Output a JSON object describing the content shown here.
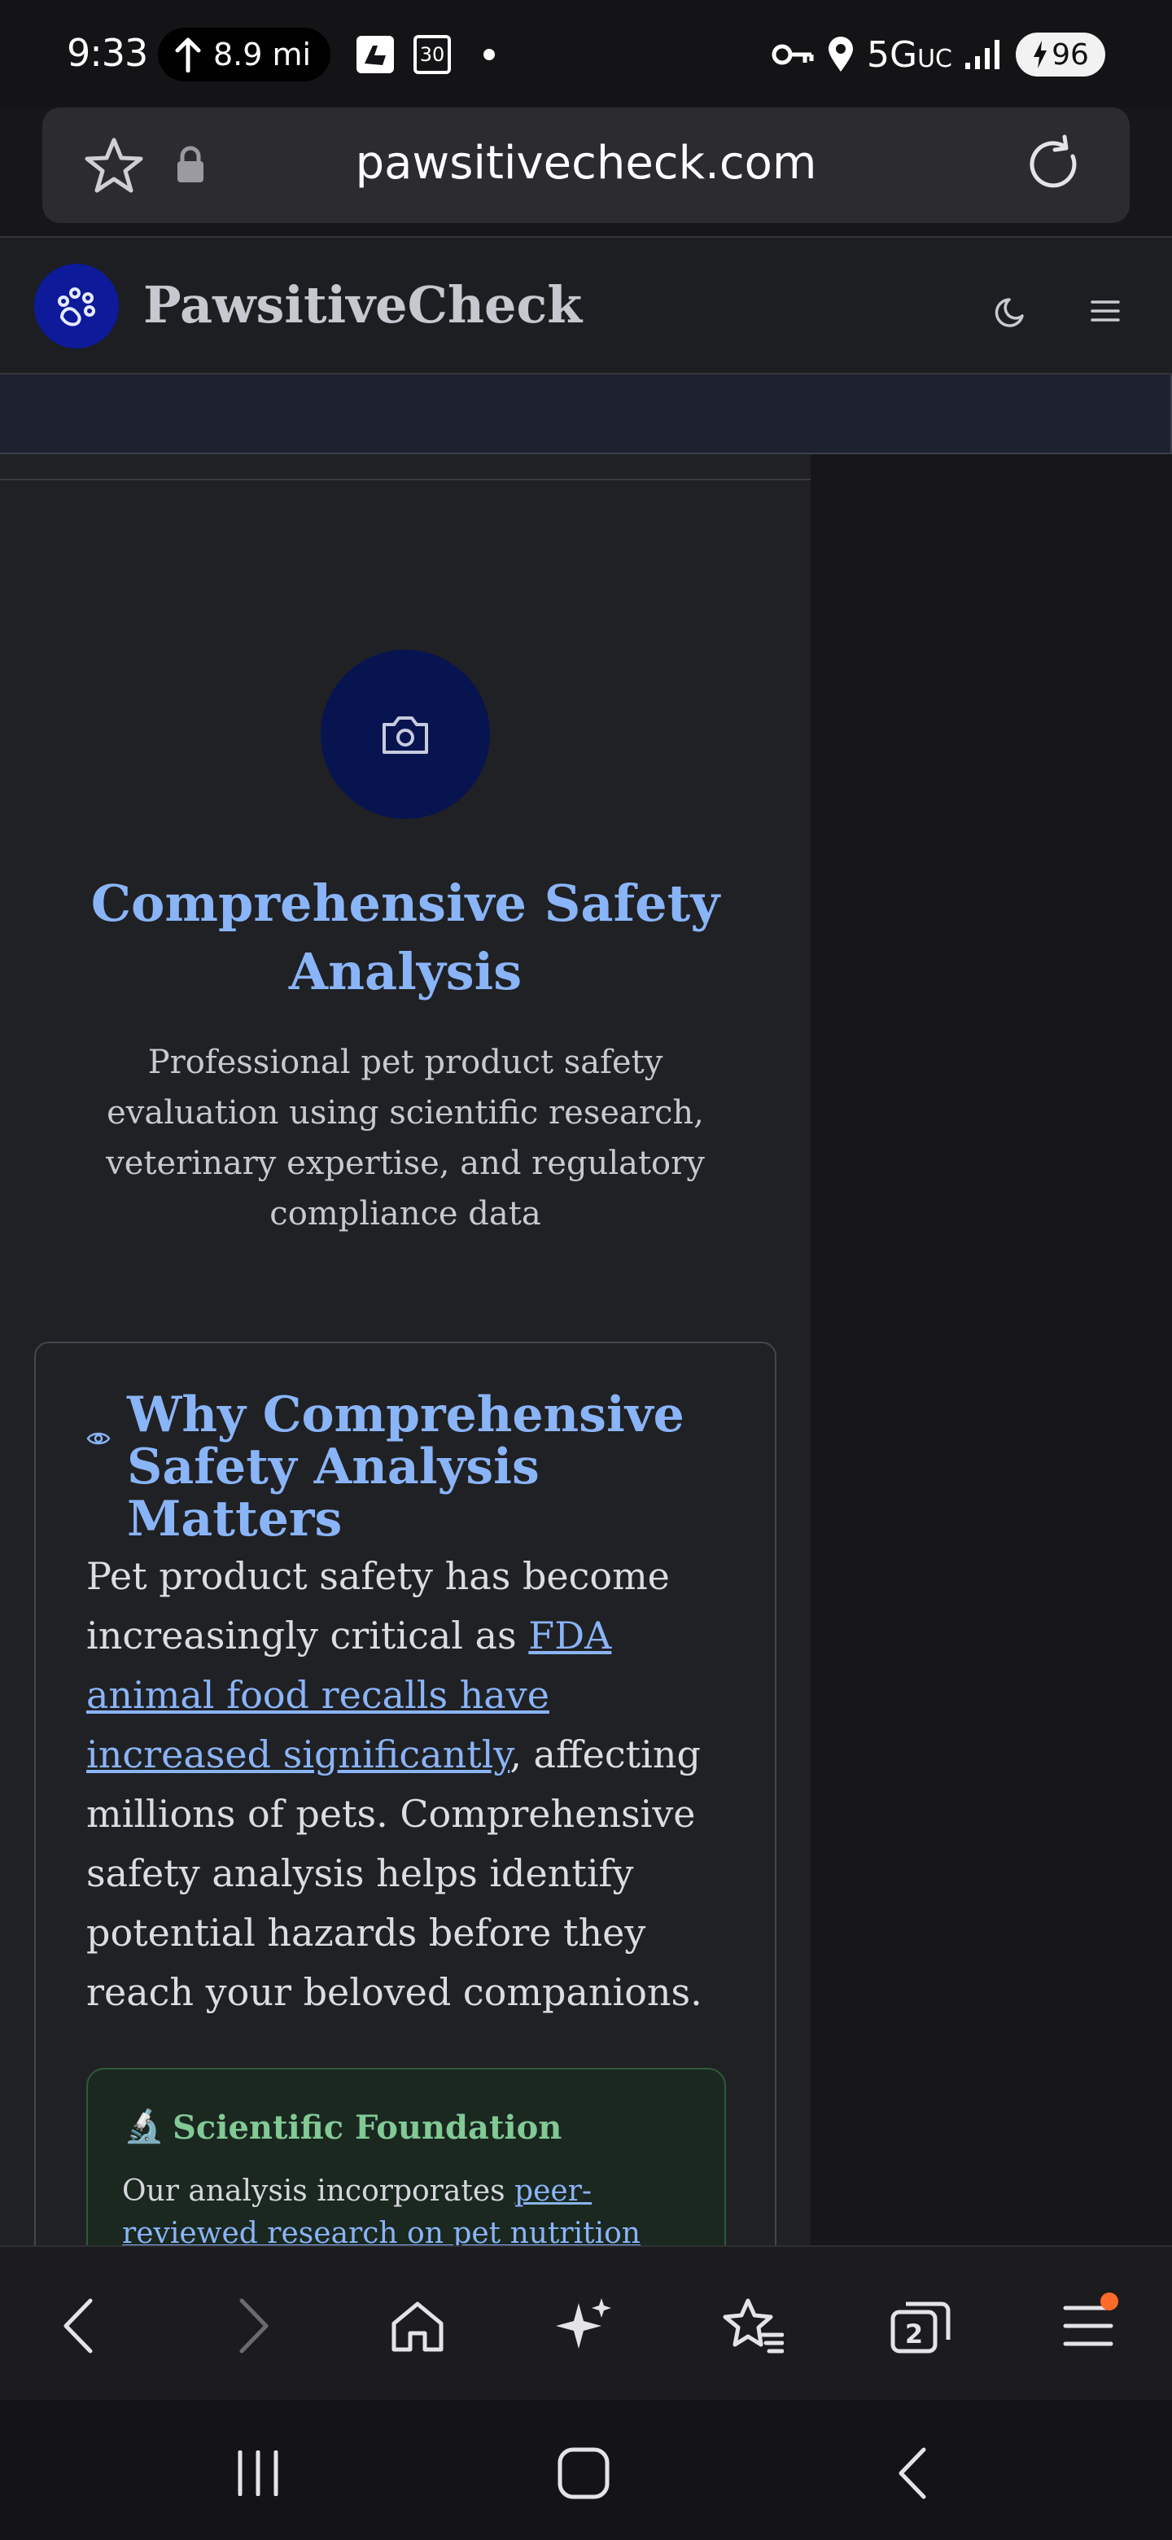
{
  "status_bar": {
    "time": "9:33",
    "nav_distance": "8.9 mi",
    "calendar_day": "30",
    "network": "5G",
    "network_suffix": "UC",
    "battery": "96"
  },
  "browser": {
    "url": "pawsitivecheck.com"
  },
  "site": {
    "name": "PawsitiveCheck"
  },
  "hero": {
    "title": "Comprehensive Safety Analysis",
    "subtitle": "Professional pet product safety evaluation using scientific research, veterinary expertise, and regulatory compliance data"
  },
  "card": {
    "title": "Why Comprehensive Safety Analysis Matters",
    "body_before": "Pet product safety has become increasingly critical as ",
    "body_link": "FDA animal food recalls have increased significantly",
    "body_after": ", affecting millions of pets. Comprehensive safety analysis helps identify potential hazards before they reach your beloved companions."
  },
  "scientific": {
    "icon": "🔬",
    "title": "Scientific Foundation",
    "body_before": "Our analysis incorporates ",
    "body_link": "peer-reviewed research on pet nutrition"
  },
  "toolbar": {
    "tab_count": "2"
  },
  "colors": {
    "accent_blue": "#8ab4f8",
    "logo_bg": "#0d1a9a",
    "green_title": "#81c995",
    "notification": "#ff6a2a"
  }
}
